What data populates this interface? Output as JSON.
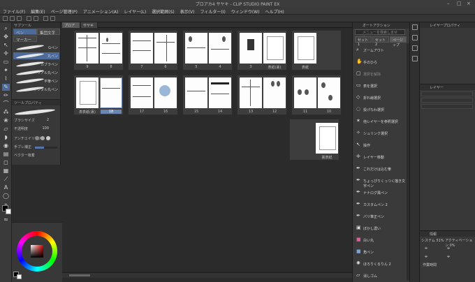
{
  "window": {
    "title": "プロアカ4 サヤキ - CLIP STUDIO PAINT EX",
    "controls": [
      "–",
      "□",
      "×"
    ]
  },
  "menu": [
    "ファイル(F)",
    "編集(E)",
    "ページ管理(P)",
    "アニメーション(A)",
    "レイヤー(L)",
    "選択範囲(S)",
    "表示(V)",
    "フィルター(I)",
    "ウィンドウ(W)",
    "ヘルプ(H)"
  ],
  "subtool": {
    "header": "サブツール",
    "tabs": [
      "ペン",
      "集団文字"
    ],
    "tab2": "マーカー",
    "brushes": [
      "Gペン",
      "丸ペン",
      "カブラペン",
      "リアル丸ペン",
      "平筆ペン",
      "デジタル丸ペン"
    ]
  },
  "toolprop": {
    "header": "ツールプロパティ",
    "brush_size_label": "ブラシサイズ",
    "brush_size_value": "2",
    "opacity_label": "不透明度",
    "opacity_value": "100",
    "aa_label": "アンチエイリアス",
    "stabilize_label": "手ブレ補正",
    "vector_label": "ベクター吸着"
  },
  "canvas_tabs": [
    "プロアカ4",
    "サヤキ"
  ],
  "pages": {
    "row1": [
      {
        "left": "9",
        "right": "8"
      },
      {
        "left": "7",
        "right": "6"
      },
      {
        "left": "5",
        "right": "4"
      },
      {
        "left": "3",
        "right": "表紙(裏)"
      },
      {
        "single": "表紙"
      }
    ],
    "row2": [
      {
        "left": "表表紙(裏)",
        "right": "18"
      },
      {
        "left": "17",
        "right": "16"
      },
      {
        "left": "15",
        "right": "14"
      },
      {
        "left": "13",
        "right": "12"
      },
      {
        "left": "11",
        "right": "10"
      }
    ],
    "row3": [
      {
        "single": "裏表紙"
      }
    ]
  },
  "autoaction": {
    "header": "オートアクション",
    "search_placeholder": "メニューを検索しません",
    "tabs": [
      "セット1",
      "セット2",
      "ページップ"
    ],
    "items": [
      "ズームアウト",
      "手のひら",
      "選択を解除",
      "表を選択",
      "折れ線選択",
      "投げなわ選択",
      "他レイヤーを参照選択",
      "シュリンク選択",
      "操作",
      "レイヤー移動",
      "これだけは込む筆",
      "ちょっぴりくっつく描き文字ペン",
      "ナナログ風ペン",
      "カスタムペン 2",
      "パリ筆正ペン",
      "ぼかし濃い",
      "白い丸",
      "角ペン",
      "ほろりくるりん 2",
      "消しゴム"
    ]
  },
  "rightpanel": {
    "layerprop_header": "レイヤープロパティ",
    "layer_header": "レイヤー",
    "info_header": "情報",
    "info_tabs": [
      "システム 51%",
      "アクティベーション 0%"
    ],
    "info_label": "作業時間"
  }
}
